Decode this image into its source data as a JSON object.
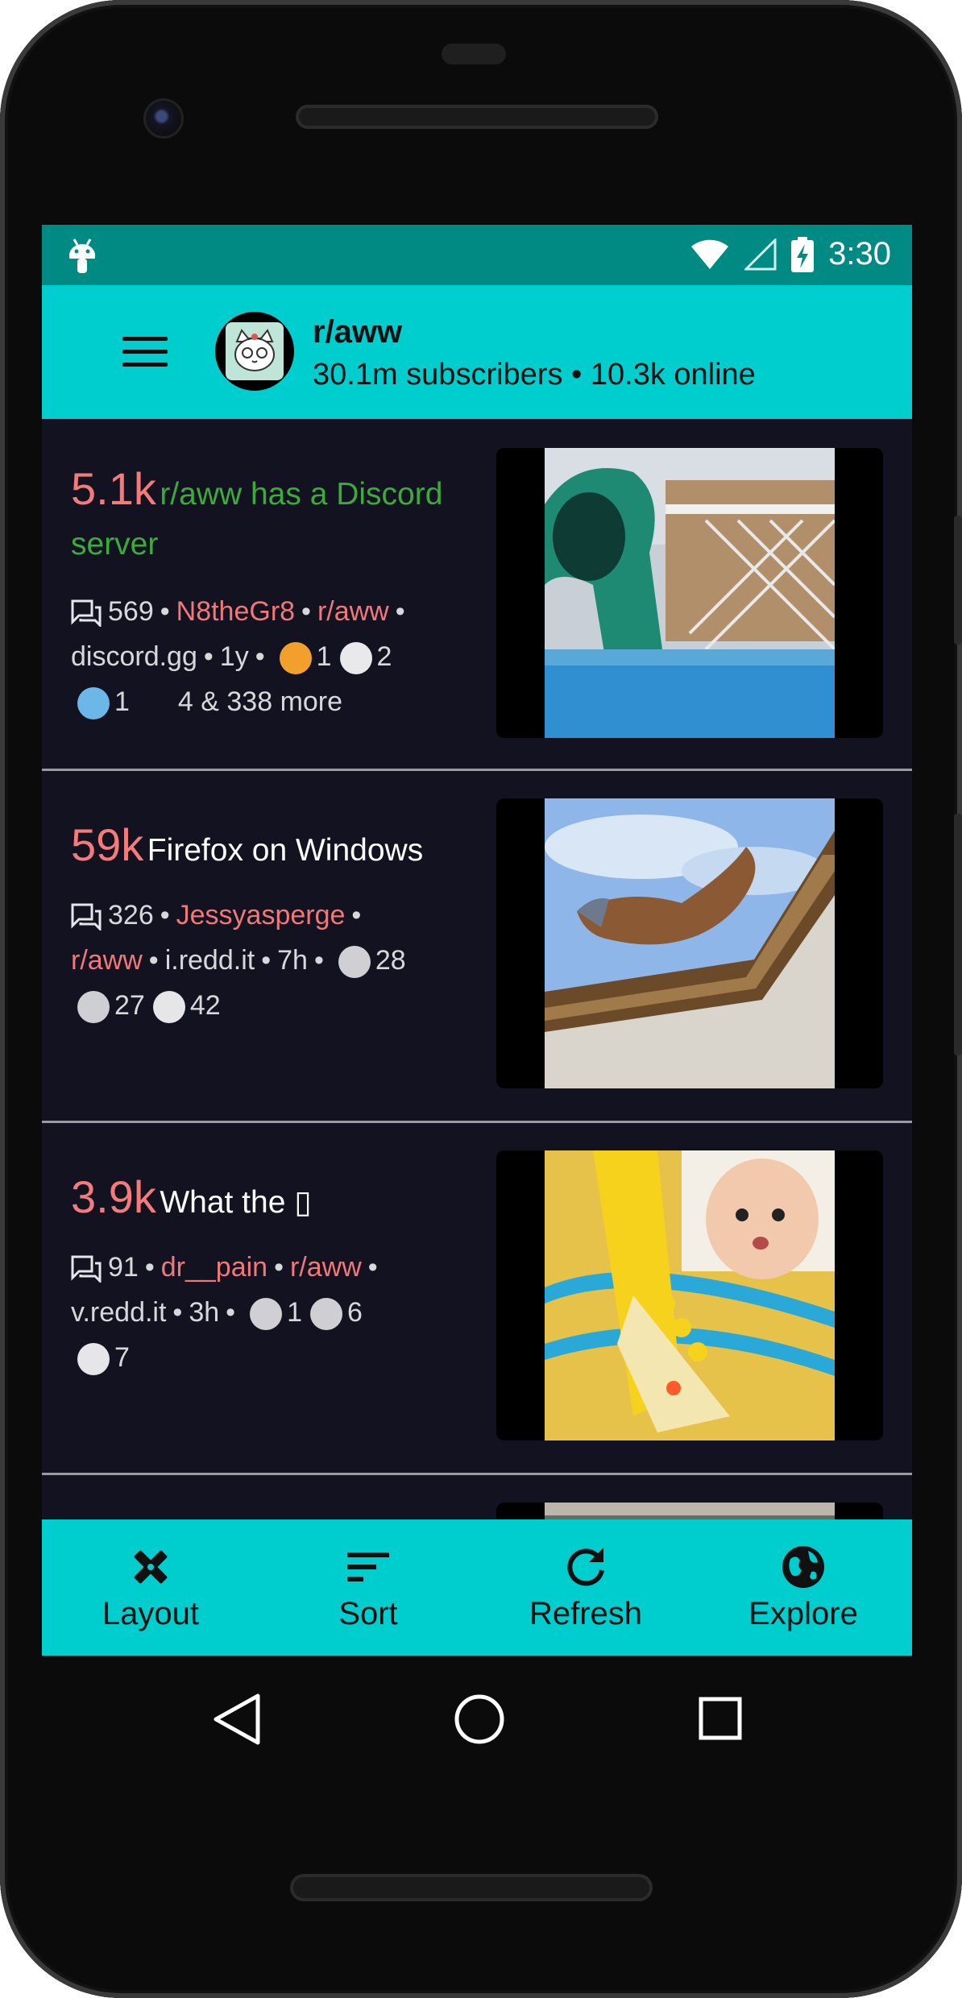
{
  "status_bar": {
    "time": "3:30"
  },
  "app_bar": {
    "subreddit": "r/aww",
    "info": "30.1m subscribers • 10.3k online"
  },
  "posts": [
    {
      "score": "5.1k",
      "title": "r/aww has a Discord server",
      "comments": "569",
      "author": "N8theGr8",
      "subreddit": "r/aww",
      "domain": "discord.gg",
      "age": "1y",
      "award1": "1",
      "award2": "2",
      "award3": "1",
      "more": "4 & 338 more"
    },
    {
      "score": "59k",
      "title": "Firefox on Windows",
      "comments": "326",
      "author": "Jessyasperge",
      "subreddit": "r/aww",
      "domain": "i.redd.it",
      "age": "7h",
      "award1": "28",
      "award2": "27",
      "award3": "42"
    },
    {
      "score": "3.9k",
      "title": "What the ▯",
      "comments": "91",
      "author": "dr__pain",
      "subreddit": "r/aww",
      "domain": "v.redd.it",
      "age": "3h",
      "award1": "1",
      "award2": "6",
      "award3": "7"
    }
  ],
  "bottom_nav": [
    {
      "label": "Layout",
      "icon": "layout-tools-icon"
    },
    {
      "label": "Sort",
      "icon": "sort-icon"
    },
    {
      "label": "Refresh",
      "icon": "refresh-icon"
    },
    {
      "label": "Explore",
      "icon": "globe-icon"
    }
  ],
  "colors": {
    "status_bar": "#008a84",
    "app_bar": "#00cdcd",
    "feed_bg": "#121221",
    "score": "#f47b7b",
    "meta_accent": "#f07878",
    "pinned_title": "#3cab3c"
  }
}
